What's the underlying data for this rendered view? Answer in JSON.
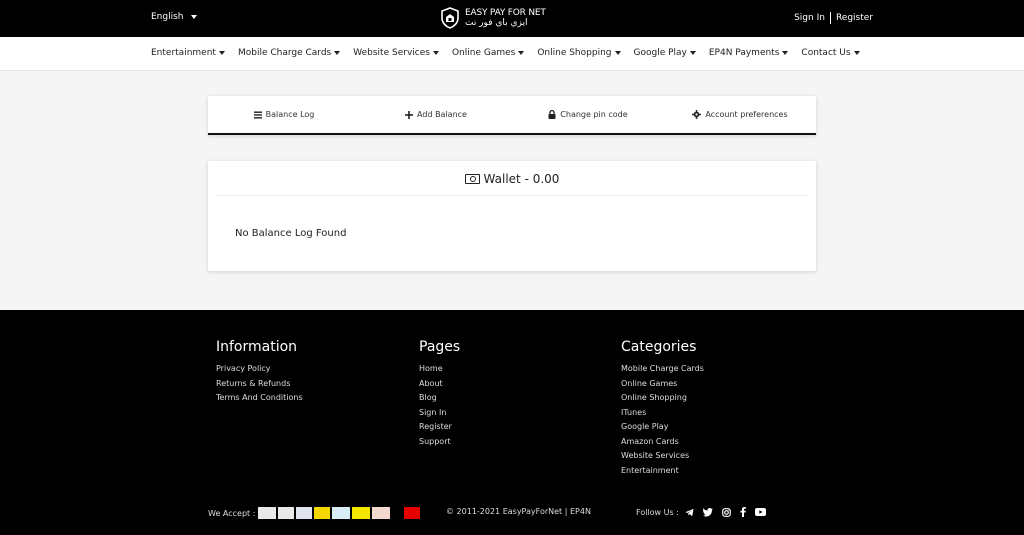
{
  "header": {
    "language": "English",
    "brand_en": "EASY PAY FOR NET",
    "brand_ar": "ايزي باي فور نت",
    "sign_in": "Sign In",
    "register": "Register"
  },
  "nav": {
    "items": [
      {
        "label": "Entertainment"
      },
      {
        "label": "Mobile Charge Cards"
      },
      {
        "label": "Website Services"
      },
      {
        "label": "Online Games"
      },
      {
        "label": "Online Shopping"
      },
      {
        "label": "Google Play"
      },
      {
        "label": "EP4N Payments"
      },
      {
        "label": "Contact Us"
      }
    ]
  },
  "tabs": [
    {
      "label": "Balance Log",
      "icon": "list-icon"
    },
    {
      "label": "Add Balance",
      "icon": "plus-icon"
    },
    {
      "label": "Change pin code",
      "icon": "lock-icon"
    },
    {
      "label": "Account preferences",
      "icon": "gear-icon"
    }
  ],
  "wallet": {
    "title": "Wallet - 0.00",
    "empty_message": "No Balance Log Found"
  },
  "footer": {
    "information": {
      "title": "Information",
      "items": [
        "Privacy Policy",
        "Returns & Refunds",
        "Terms And Conditions"
      ]
    },
    "pages": {
      "title": "Pages",
      "items": [
        "Home",
        "About",
        "Blog",
        "Sign In",
        "Register",
        "Support"
      ]
    },
    "categories": {
      "title": "Categories",
      "items": [
        "Mobile Charge Cards",
        "Online Games",
        "Online Shopping",
        "ITunes",
        "Google Play",
        "Amazon Cards",
        "Website Services",
        "Entertainment"
      ]
    },
    "we_accept": "We Accept :",
    "copyright": "© 2011-2021 EasyPayForNet | EP4N",
    "follow_us": "Follow Us :"
  },
  "colors": {
    "header_bg": "#000000",
    "footer_bg": "#000000",
    "page_bg": "#f5f5f5"
  }
}
